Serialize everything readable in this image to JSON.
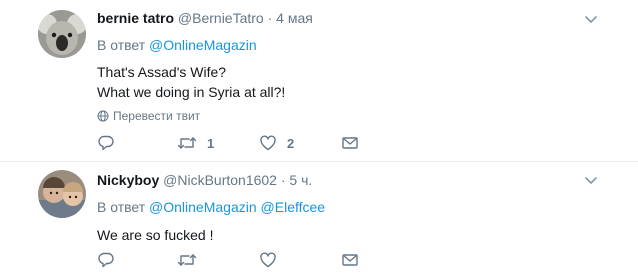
{
  "tweets": [
    {
      "fullname": "bernie tatro",
      "username": "@BernieTatro",
      "dot": "·",
      "time": "4 мая",
      "reply_prefix": "В ответ",
      "reply_mentions": [
        "@OnlineMagazin"
      ],
      "text_lines": [
        "That's Assad's Wife?",
        "What we doing in Syria at all?!"
      ],
      "translate_label": "Перевести твит",
      "counts": {
        "reply": "",
        "retweet": "1",
        "like": "2"
      }
    },
    {
      "fullname": "Nickyboy",
      "username": "@NickBurton1602",
      "dot": "·",
      "time": "5 ч.",
      "reply_prefix": "В ответ",
      "reply_mentions": [
        "@OnlineMagazin",
        "@Eleffcee"
      ],
      "text_lines": [
        "We are so fucked !"
      ],
      "counts": {
        "reply": "",
        "retweet": "",
        "like": ""
      }
    }
  ],
  "colors": {
    "link": "#1b95e0",
    "secondary": "#657786",
    "primary_text": "#14171a",
    "divider": "#e6ecf0"
  },
  "icons": [
    "koala-avatar",
    "user-photo-avatar",
    "chevron-down-icon",
    "globe-icon",
    "reply-icon",
    "retweet-icon",
    "like-icon",
    "direct-message-icon"
  ]
}
